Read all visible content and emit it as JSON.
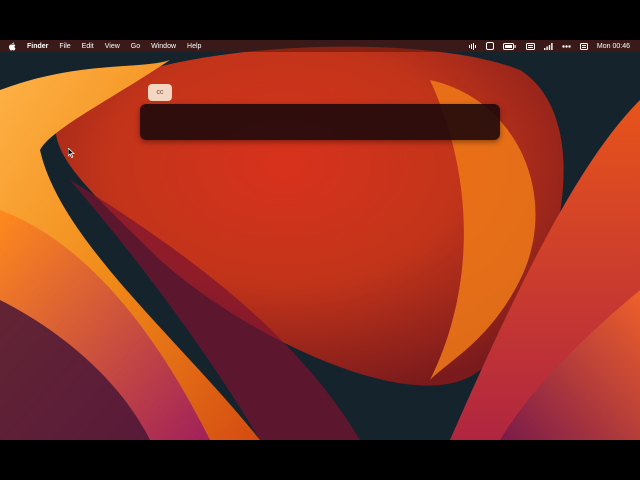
{
  "menubar": {
    "apple_icon": "apple-icon",
    "app_name": "Finder",
    "items": [
      "File",
      "Edit",
      "View",
      "Go",
      "Window",
      "Help"
    ],
    "status_icons": [
      "audio-icon",
      "screen-icon",
      "battery-icon",
      "keyboard-icon",
      "wifi-icon",
      "more-icon",
      "control-center-icon"
    ],
    "clock": "Mon 00:46"
  },
  "overlay": {
    "tag_label": "cc",
    "input_value": ""
  },
  "colors": {
    "wallpaper_dark": "#16202a",
    "wallpaper_orange": "#f28a1a",
    "wallpaper_red": "#c83a1a",
    "panel_bg": "#23090c",
    "tag_bg": "#f4d7c3"
  }
}
